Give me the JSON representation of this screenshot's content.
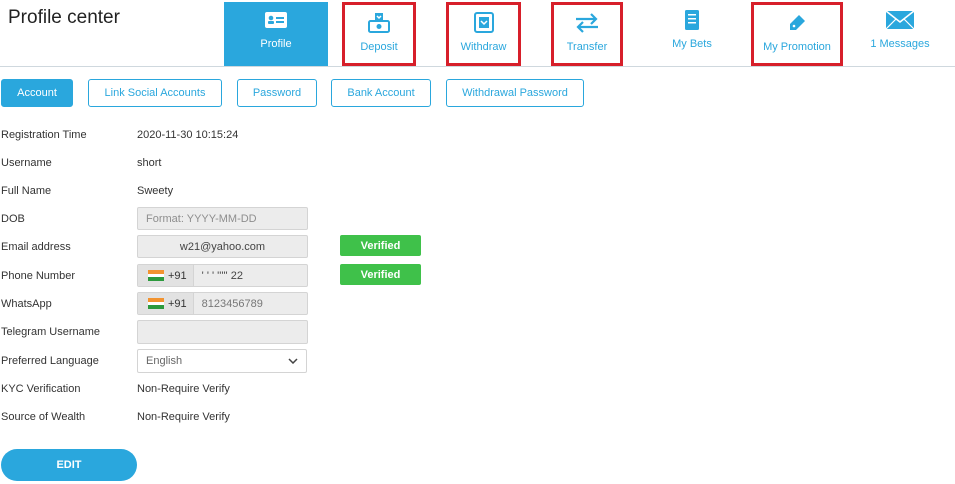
{
  "header": {
    "title": "Profile center"
  },
  "nav": {
    "profile": {
      "label": "Profile",
      "icon": "profile-card-icon"
    },
    "deposit": {
      "label": "Deposit",
      "icon": "deposit-icon"
    },
    "withdraw": {
      "label": "Withdraw",
      "icon": "atm-withdraw-icon"
    },
    "transfer": {
      "label": "Transfer",
      "icon": "transfer-arrows-icon"
    },
    "my_bets": {
      "label": "My Bets",
      "icon": "bet-slip-icon"
    },
    "my_promotion": {
      "label": "My Promotion",
      "icon": "tag-icon"
    },
    "messages": {
      "label": "1 Messages",
      "icon": "envelope-icon"
    }
  },
  "subtabs": {
    "account": "Account",
    "link_social": "Link Social Accounts",
    "password": "Password",
    "bank_account": "Bank Account",
    "withdrawal_password": "Withdrawal Password"
  },
  "profile": {
    "registration_time_label": "Registration Time",
    "registration_time": "2020-11-30 10:15:24",
    "username_label": "Username",
    "username": "short",
    "full_name_label": "Full Name",
    "full_name": "Sweety",
    "dob_label": "DOB",
    "dob_placeholder": "Format: YYYY-MM-DD",
    "email_label": "Email address",
    "email": "w21@yahoo.com",
    "email_status": "Verified",
    "phone_label": "Phone Number",
    "phone_code": "+91",
    "phone": "' ' ' ''''' 22",
    "phone_status": "Verified",
    "whatsapp_label": "WhatsApp",
    "whatsapp_code": "+91",
    "whatsapp": "8123456789",
    "telegram_label": "Telegram Username",
    "telegram": "",
    "language_label": "Preferred Language",
    "language": "English",
    "kyc_label": "KYC Verification",
    "kyc": "Non-Require Verify",
    "wealth_label": "Source of Wealth",
    "wealth": "Non-Require Verify"
  },
  "actions": {
    "edit": "EDIT"
  },
  "colors": {
    "accent": "#2aa7dd",
    "verified": "#3fc14a",
    "highlight_box": "#d71f2a"
  }
}
